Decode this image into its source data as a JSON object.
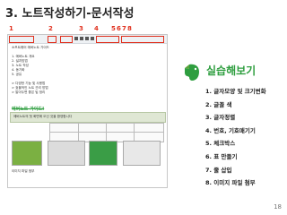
{
  "slide": {
    "title": "3. 노트작성하기-문서작성",
    "page_number": "18"
  },
  "callouts": [
    "1",
    "2",
    "3",
    "4",
    "5",
    "6",
    "7",
    "8"
  ],
  "screenshot": {
    "intro": "소프트웨어 에버노트 가이드",
    "items": [
      "1. 에버노트 개요",
      "2. 설치방법",
      "3. 노트 작성",
      "4. 동기화",
      "5. 공유"
    ],
    "bullets": [
      "> 다양한 기능 및 사용법",
      "> 효율적인 노트 관리 방법",
      "> 알아두면 좋은 팁 정리"
    ],
    "green_title": "에버노트 가이드!",
    "band_text": "에버노트의 첫 화면에 오신 것을 환영합니다",
    "bottom_line": "이미지 파일 첨부"
  },
  "practice": {
    "title": "실습해보기",
    "steps": [
      "1. 글자모양 및 크기변화",
      "2. 글꼴 색",
      "3. 글자정렬",
      "4. 번호, 기호매기기",
      "5. 체크박스",
      "6. 표 만들기",
      "7.  줄 삽입",
      "8. 이미지 파일 첨부"
    ]
  },
  "colors": {
    "accent_green": "#2e9e3f",
    "callout_red": "#e0301e"
  }
}
